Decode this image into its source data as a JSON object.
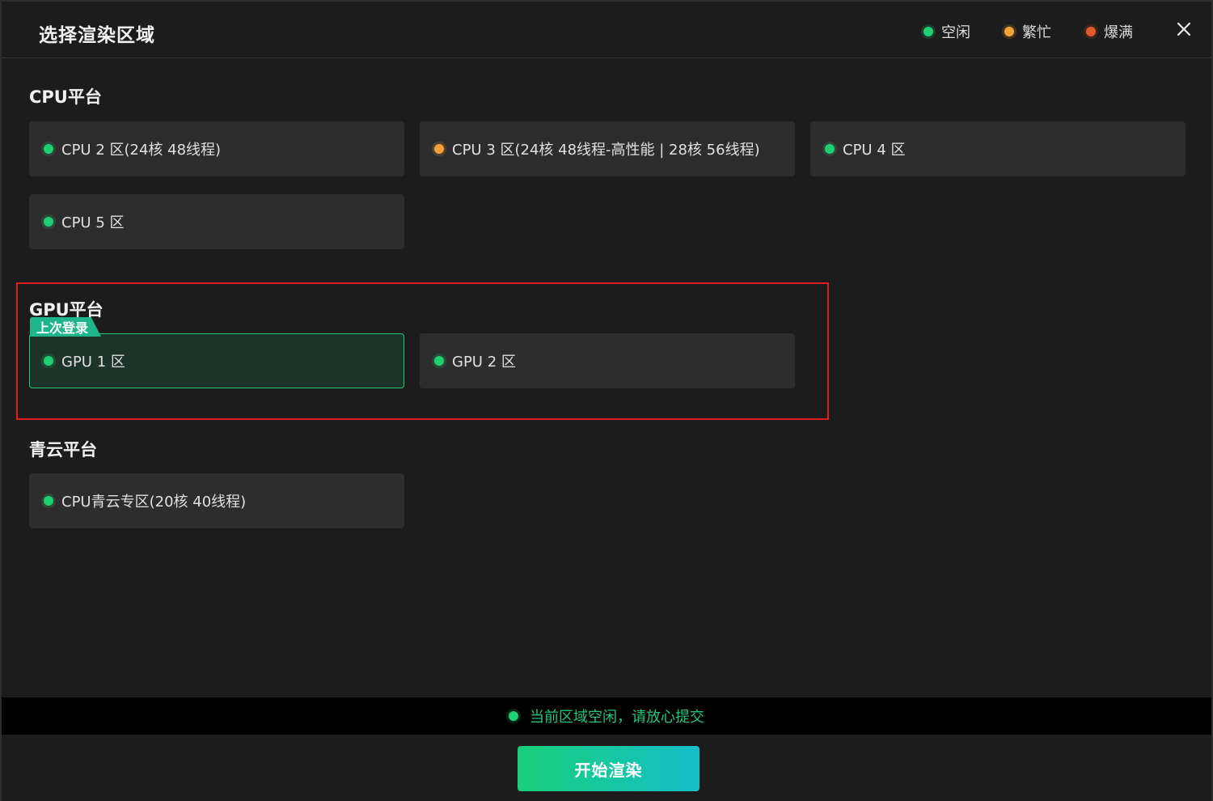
{
  "dialog": {
    "title": "选择渲染区域",
    "close_icon": "close-icon"
  },
  "legend": [
    {
      "label": "空闲",
      "color": "#1fcf72"
    },
    {
      "label": "繁忙",
      "color": "#f5a23b"
    },
    {
      "label": "爆满",
      "color": "#e05a2b"
    }
  ],
  "sections": {
    "cpu": {
      "title": "CPU平台",
      "cards": [
        {
          "label": "CPU 2 区(24核 48线程)",
          "status": "空闲"
        },
        {
          "label": "CPU 3 区(24核 48线程-高性能 | 28核 56线程)",
          "status": "繁忙"
        },
        {
          "label": "CPU 4 区",
          "status": "空闲"
        },
        {
          "label": "CPU 5 区",
          "status": "空闲"
        }
      ]
    },
    "gpu": {
      "title": "GPU平台",
      "badge": "上次登录",
      "cards": [
        {
          "label": "GPU 1 区",
          "status": "空闲",
          "selected": true
        },
        {
          "label": "GPU 2 区",
          "status": "空闲"
        }
      ]
    },
    "qingcloud": {
      "title": "青云平台",
      "cards": [
        {
          "label": "CPU青云专区(20核 40线程)",
          "status": "空闲"
        }
      ]
    }
  },
  "status_bar": {
    "text": "当前区域空闲，请放心提交",
    "color": "#22c57a"
  },
  "footer": {
    "start_label": "开始渲染"
  }
}
